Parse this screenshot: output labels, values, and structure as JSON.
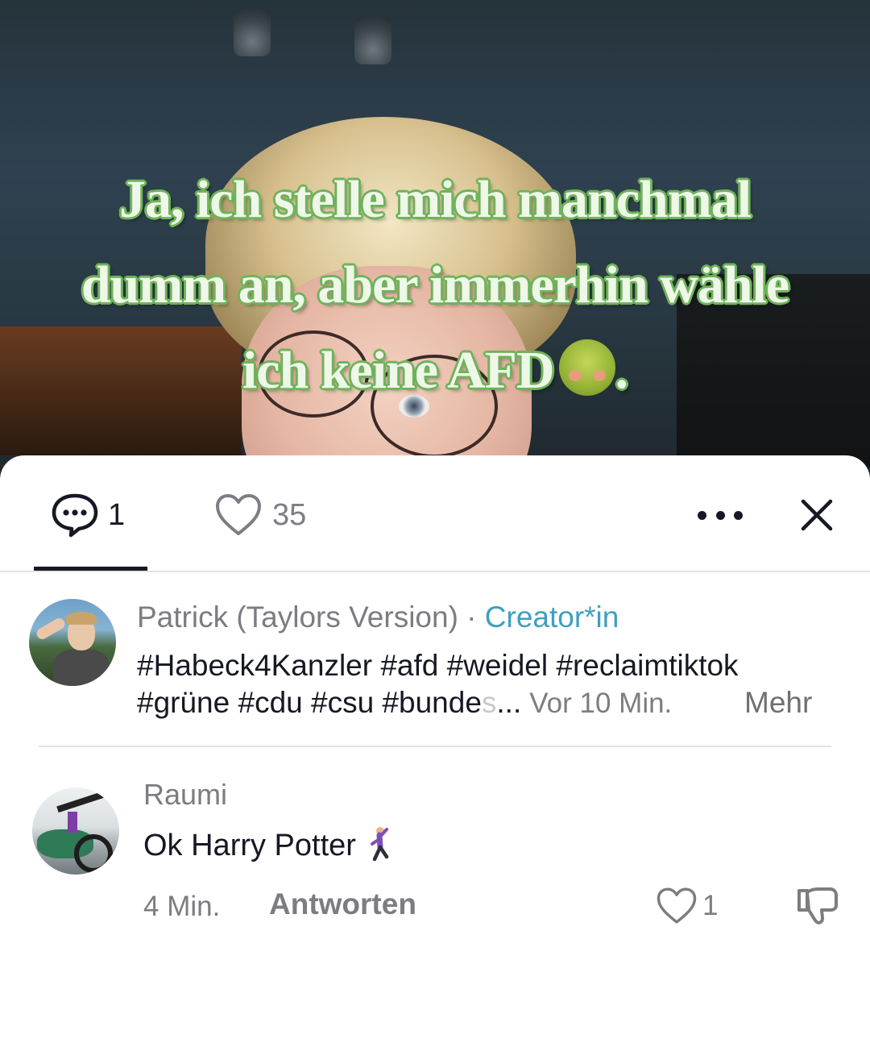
{
  "video": {
    "overlay_lines": [
      "Ja, ich stelle mich manchmal",
      "dumm an, aber immerhin wähle",
      "ich keine AFD"
    ],
    "overlay_end": ".",
    "overlay_emoji": "nauseated-face-emoji"
  },
  "tabs": {
    "comments_count": "1",
    "likes_count": "35"
  },
  "caption": {
    "author": "Patrick (Taylors Version)",
    "separator": " · ",
    "badge": "Creator*in",
    "hashtags_line1": "#Habeck4Kanzler #afd #weidel #reclaimtiktok",
    "hashtags_line2": "#grüne #cdu #csu #bunde",
    "hashtags_fade": "s",
    "ellipsis": "...",
    "time": "Vor 10 Min.",
    "more_label": "Mehr"
  },
  "comment": {
    "author": "Raumi",
    "text": "Ok Harry Potter",
    "emoji": "dancing-man-emoji",
    "time": "4 Min.",
    "reply_label": "Antworten",
    "like_count": "1"
  },
  "colors": {
    "text": "#161823",
    "secondary": "#7c7c81",
    "badge": "#3f9fbf",
    "overlay_outline": "#6fb35a"
  }
}
